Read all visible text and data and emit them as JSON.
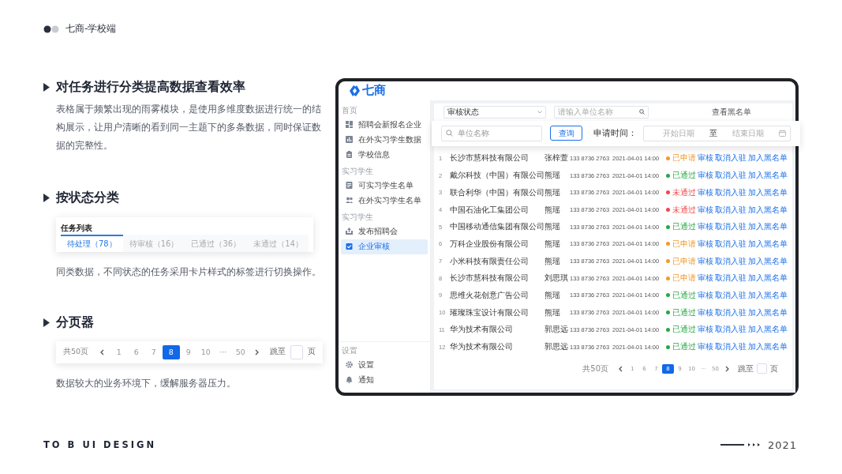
{
  "header": {
    "title": "七商-学校端"
  },
  "sections": [
    {
      "kind": "text",
      "heading": "对任务进行分类提高数据查看效率",
      "description": "表格属于频繁出现的雨雾模块，是使用多维度数据进行统一的结构展示，让用户清晰的看到同一主题下的多条数据，同时保证数据的完整性。"
    },
    {
      "kind": "tabs",
      "heading": "按状态分类",
      "card_title": "任务列表",
      "tabs": [
        {
          "label": "待处理（78）",
          "selected": true
        },
        {
          "label": "待审核（16）",
          "selected": false
        },
        {
          "label": "已通过（36）",
          "selected": false
        },
        {
          "label": "未通过（14）",
          "selected": false
        }
      ],
      "description": "同类数据，不同状态的任务采用卡片样式的标签进行切换操作。"
    },
    {
      "kind": "pager",
      "heading": "分页器",
      "pager": {
        "total": "共50页",
        "pages": [
          {
            "label": "1",
            "selected": false
          },
          {
            "label": "6",
            "selected": false
          },
          {
            "label": "7",
            "selected": false
          },
          {
            "label": "8",
            "selected": true
          },
          {
            "label": "9",
            "selected": false
          },
          {
            "label": "10",
            "selected": false
          },
          {
            "label": "···",
            "selected": false
          },
          {
            "label": "50",
            "selected": false
          }
        ],
        "jump_label": "跳至",
        "unit": "页"
      },
      "description": "数据较大的业务环境下，缓解服务器压力。"
    }
  ],
  "device": {
    "logo": "七商",
    "sidebar": {
      "groups": [
        {
          "label": "首页",
          "items": [
            {
              "label": "招聘会新报名企业",
              "selected": false
            },
            {
              "label": "在外实习学生数据",
              "selected": false
            },
            {
              "label": "学校信息",
              "selected": false
            }
          ]
        },
        {
          "label": "实习学生",
          "items": [
            {
              "label": "可实习学生名单",
              "selected": false
            },
            {
              "label": "在外实习学生名单",
              "selected": false
            }
          ]
        },
        {
          "label": "实习学生",
          "items": [
            {
              "label": "发布招聘会",
              "selected": false
            },
            {
              "label": "企业审核",
              "selected": true
            }
          ]
        }
      ],
      "bottom_group": {
        "label": "设置",
        "items": [
          {
            "label": "设置",
            "selected": false
          },
          {
            "label": "通知",
            "selected": false
          }
        ]
      }
    },
    "filter": {
      "select": "审核状态",
      "search_placeholder": "请输入单位名称",
      "link": "查看黑名单"
    },
    "search_overlay": {
      "placeholder": "单位名称",
      "button": "查询",
      "date_label": "申请时间：",
      "start_placeholder": "开始日期",
      "separator": "至",
      "end_placeholder": "结束日期"
    },
    "table": {
      "rows": [
        {
          "index": "1",
          "company": "长沙市慧科技有限公司",
          "contact": "张梓萱",
          "phone": "133 8736 2763",
          "time": "2021-04-01 14:00",
          "status": "已申请",
          "color": "#f39a2b",
          "actions": [
            "审核",
            "取消入驻",
            "加入黑名单"
          ]
        },
        {
          "index": "2",
          "company": "戴尔科技（中国）有限公司",
          "contact": "熊瑶",
          "phone": "133 8736 2763",
          "time": "2021-04-01 14:00",
          "status": "已通过",
          "color": "#28a745",
          "actions": [
            "审核",
            "取消入驻",
            "加入黑名单"
          ]
        },
        {
          "index": "3",
          "company": "联合利华（中国）有限公司",
          "contact": "熊瑶",
          "phone": "133 8736 2763",
          "time": "2021-04-01 14:00",
          "status": "未通过",
          "color": "#f04848",
          "actions": [
            "审核",
            "取消入驻",
            "加入黑名单"
          ]
        },
        {
          "index": "4",
          "company": "中国石油化工集团公司",
          "contact": "熊瑶",
          "phone": "133 8736 2763",
          "time": "2021-04-01 14:00",
          "status": "未通过",
          "color": "#f04848",
          "actions": [
            "审核",
            "取消入驻",
            "加入黑名单"
          ]
        },
        {
          "index": "5",
          "company": "中国移动通信集团有限公司",
          "contact": "熊瑶",
          "phone": "133 8736 2763",
          "time": "2021-04-01 14:00",
          "status": "已通过",
          "color": "#28a745",
          "actions": [
            "审核",
            "取消入驻",
            "加入黑名单"
          ]
        },
        {
          "index": "6",
          "company": "万科企业股份有限公司",
          "contact": "熊瑶",
          "phone": "133 8736 2763",
          "time": "2021-04-01 14:00",
          "status": "已申请",
          "color": "#f39a2b",
          "actions": [
            "审核",
            "取消入驻",
            "加入黑名单"
          ]
        },
        {
          "index": "7",
          "company": "小米科技有限责任公司",
          "contact": "熊瑶",
          "phone": "133 8736 2763",
          "time": "2021-04-01 14:00",
          "status": "已申请",
          "color": "#f39a2b",
          "actions": [
            "审核",
            "取消入驻",
            "加入黑名单"
          ]
        },
        {
          "index": "8",
          "company": "长沙市慧科技有限公司",
          "contact": "刘思琪",
          "phone": "133 8736 2763",
          "time": "2021-04-01 14:00",
          "status": "已申请",
          "color": "#f39a2b",
          "actions": [
            "审核",
            "取消入驻",
            "加入黑名单"
          ]
        },
        {
          "index": "9",
          "company": "思维火花创意广告公司",
          "contact": "熊瑶",
          "phone": "133 8736 2763",
          "time": "2021-04-01 14:00",
          "status": "已通过",
          "color": "#28a745",
          "actions": [
            "审核",
            "取消入驻",
            "加入黑名单"
          ]
        },
        {
          "index": "10",
          "company": "璀璨珠宝设计有限公司",
          "contact": "熊瑶",
          "phone": "133 8736 2763",
          "time": "2021-04-01 14:00",
          "status": "已通过",
          "color": "#28a745",
          "actions": [
            "审核",
            "取消入驻",
            "加入黑名单"
          ]
        },
        {
          "index": "11",
          "company": "华为技术有限公司",
          "contact": "郭思远",
          "phone": "133 8736 2763",
          "time": "2021-04-01 14:00",
          "status": "已通过",
          "color": "#28a745",
          "actions": [
            "审核",
            "取消入驻",
            "加入黑名单"
          ]
        },
        {
          "index": "12",
          "company": "华为技术有限公司",
          "contact": "郭思远",
          "phone": "133 8736 2763",
          "time": "2021-04-01 14:00",
          "status": "已通过",
          "color": "#28a745",
          "actions": [
            "审核",
            "取消入驻",
            "加入黑名单"
          ]
        }
      ]
    },
    "pager": {
      "total": "共50页",
      "pages": [
        {
          "label": "1",
          "selected": false
        },
        {
          "label": "6",
          "selected": false
        },
        {
          "label": "7",
          "selected": false
        },
        {
          "label": "8",
          "selected": true
        },
        {
          "label": "9",
          "selected": false
        },
        {
          "label": "10",
          "selected": false
        },
        {
          "label": "···",
          "selected": false
        },
        {
          "label": "50",
          "selected": false
        }
      ],
      "jump_label": "跳至",
      "unit": "页"
    }
  },
  "footer": {
    "caption": "TO B UI DESIGN",
    "year": "2021"
  }
}
